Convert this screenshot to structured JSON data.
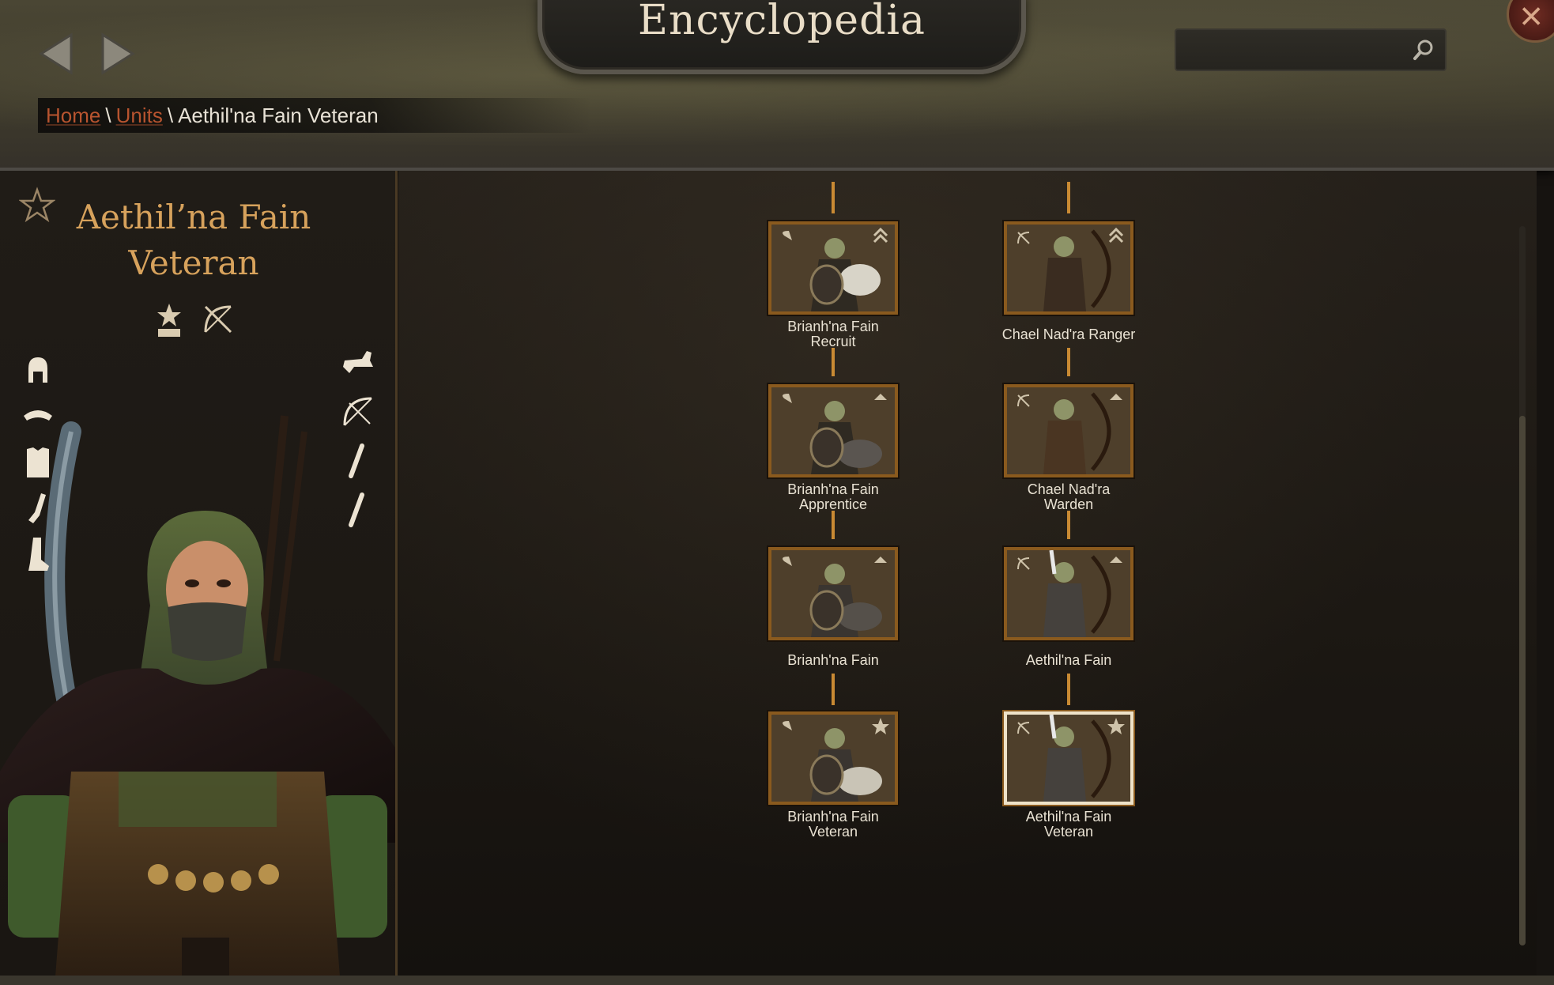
{
  "header": {
    "title": "Encyclopedia",
    "search_placeholder": ""
  },
  "breadcrumb": {
    "home": "Home",
    "section": "Units",
    "current": "Aethil'na Fain Veteran",
    "separator": "\\"
  },
  "unit": {
    "name_line1": "Aethil’na Fain",
    "name_line2": "Veteran",
    "class_icons": [
      "tier-star-icon",
      "bow-icon"
    ],
    "equipment_left": [
      "helmet-icon",
      "cape-icon",
      "body-armor-icon",
      "gloves-icon",
      "boots-icon"
    ],
    "equipment_right": [
      "horse-icon",
      "bow-icon",
      "arrows-icon",
      "arrows-icon"
    ]
  },
  "tree": {
    "columns": [
      {
        "units": [
          {
            "name": "Brianh'na Fain\nRecruit",
            "rank_icon": "double-chevron-icon"
          },
          {
            "name": "Brianh'na Fain\nApprentice",
            "rank_icon": "chevron-icon"
          },
          {
            "name": "Brianh'na Fain",
            "rank_icon": "chevron-icon"
          },
          {
            "name": "Brianh'na Fain\nVeteran",
            "rank_icon": "star-icon"
          }
        ]
      },
      {
        "units": [
          {
            "name": "Chael Nad'ra Ranger",
            "rank_icon": "double-chevron-icon"
          },
          {
            "name": "Chael Nad'ra\nWarden",
            "rank_icon": "chevron-icon"
          },
          {
            "name": "Aethil'na Fain",
            "rank_icon": "chevron-icon"
          },
          {
            "name": "Aethil'na Fain\nVeteran",
            "rank_icon": "star-icon",
            "selected": true
          }
        ]
      }
    ]
  },
  "colors": {
    "accent_gold": "#d7a25c",
    "connector": "#c98a33",
    "link": "#b8542f",
    "card_border": "#8a5a1e",
    "card_selected_border": "#efe3c9"
  }
}
